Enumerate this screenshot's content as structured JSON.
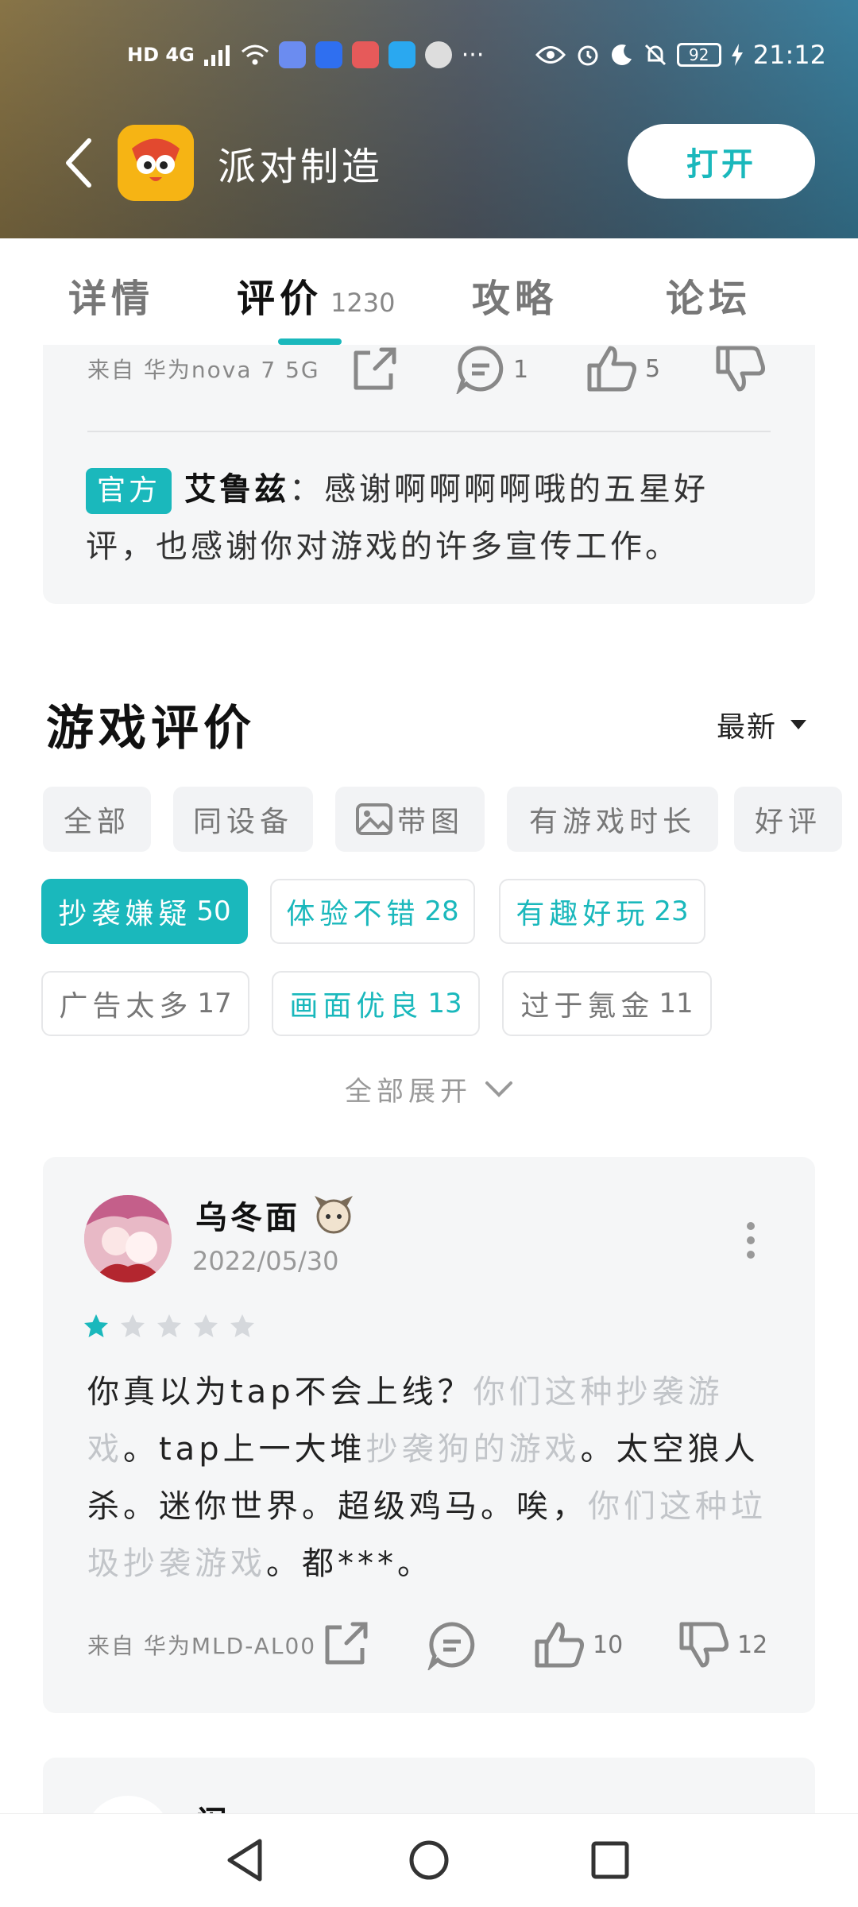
{
  "status_bar": {
    "network": "HD 4G",
    "battery": "92",
    "time": "21:12"
  },
  "header": {
    "app_title": "派对制造",
    "open_label": "打开"
  },
  "tabs": [
    {
      "label": "详情"
    },
    {
      "label": "评价",
      "count": "1230"
    },
    {
      "label": "攻略"
    },
    {
      "label": "论坛"
    }
  ],
  "prev_review": {
    "device": "来自 华为nova 7 5G",
    "comment_count": "1",
    "like_count": "5",
    "official_badge": "官方",
    "dev_name": "艾鲁兹",
    "dev_reply": "：感谢啊啊啊啊哦的五星好评，也感谢你对游戏的许多宣传工作。"
  },
  "section": {
    "title": "游戏评价",
    "sort_label": "最新"
  },
  "filters": [
    {
      "label": "全部"
    },
    {
      "label": "同设备"
    },
    {
      "label": "带图"
    },
    {
      "label": "有游戏时长"
    },
    {
      "label": "好评"
    }
  ],
  "tags": [
    {
      "label": "抄袭嫌疑",
      "count": "50"
    },
    {
      "label": "体验不错",
      "count": "28"
    },
    {
      "label": "有趣好玩",
      "count": "23"
    },
    {
      "label": "广告太多",
      "count": "17"
    },
    {
      "label": "画面优良",
      "count": "13"
    },
    {
      "label": "过于氪金",
      "count": "11"
    }
  ],
  "expand_label": "全部展开",
  "review": {
    "username": "乌冬面",
    "date": "2022/05/30",
    "rating": 1,
    "text_1": "你真以为tap不会上线？",
    "text_2": "你们这种抄袭游戏",
    "text_3": "。tap上一大堆",
    "text_4": "抄袭狗的游戏",
    "text_5": "。太空狼人杀。迷你世界。超级鸡马。唉，",
    "text_6": "你们这种垃圾抄袭游戏",
    "text_7": "。都***。",
    "device": "来自 华为MLD-AL00",
    "like_count": "10",
    "dislike_count": "12"
  },
  "next_review": {
    "username_partial": "阑"
  },
  "colors": {
    "accent": "#1ab8bc",
    "card_bg": "#f5f6f7"
  }
}
